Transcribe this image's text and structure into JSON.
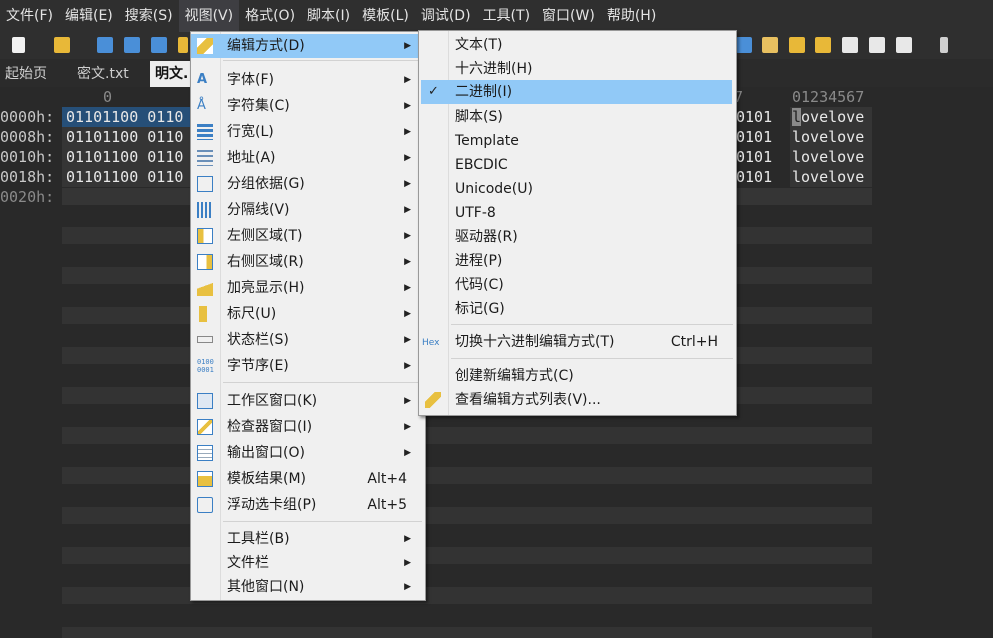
{
  "menubar": [
    "文件(F)",
    "编辑(E)",
    "搜索(S)",
    "视图(V)",
    "格式(O)",
    "脚本(I)",
    "模板(L)",
    "调试(D)",
    "工具(T)",
    "窗口(W)",
    "帮助(H)"
  ],
  "tabs": [
    "起始页",
    "密文.txt",
    "明文."
  ],
  "ruler": {
    "left": "0",
    "right_digit": "7",
    "text_header": "01234567"
  },
  "rows": [
    {
      "addr": "0000h:",
      "bin": "01101100 0110",
      "tail": "0101",
      "text": "lovelove",
      "selected": true
    },
    {
      "addr": "0008h:",
      "bin": "01101100 0110",
      "tail": "0101",
      "text": "lovelove",
      "selected": false
    },
    {
      "addr": "0010h:",
      "bin": "01101100 0110",
      "tail": "0101",
      "text": "lovelove",
      "selected": false
    },
    {
      "addr": "0018h:",
      "bin": "01101100 0110",
      "tail": "0101",
      "text": "lovelove",
      "selected": false
    },
    {
      "addr": "0020h:",
      "bin": "",
      "tail": "",
      "text": "",
      "selected": false
    }
  ],
  "view_menu": [
    {
      "label": "编辑方式(D)",
      "icon": "pencil-icon",
      "submenu": true,
      "highlighted": true
    },
    {
      "label": "字体(F)",
      "icon": "font-icon",
      "submenu": true
    },
    {
      "label": "字符集(C)",
      "icon": "charset-icon",
      "submenu": true
    },
    {
      "label": "行宽(L)",
      "icon": "line-width-icon",
      "submenu": true
    },
    {
      "label": "地址(A)",
      "icon": "address-icon",
      "submenu": true
    },
    {
      "label": "分组依据(G)",
      "icon": "group-icon",
      "submenu": true
    },
    {
      "label": "分隔线(V)",
      "icon": "divider-icon",
      "submenu": true
    },
    {
      "label": "左侧区域(T)",
      "icon": "left-area-icon",
      "submenu": true
    },
    {
      "label": "右侧区域(R)",
      "icon": "right-area-icon",
      "submenu": true
    },
    {
      "label": "加亮显示(H)",
      "icon": "highlight-icon",
      "submenu": true
    },
    {
      "label": "标尺(U)",
      "icon": "ruler-icon",
      "submenu": true
    },
    {
      "label": "状态栏(S)",
      "icon": "statusbar-icon",
      "submenu": true
    },
    {
      "label": "字节序(E)",
      "icon": "byte-order-icon",
      "submenu": true
    },
    {
      "label": "工作区窗口(K)",
      "icon": "workspace-icon",
      "submenu": true
    },
    {
      "label": "检查器窗口(I)",
      "icon": "inspector-icon",
      "submenu": true
    },
    {
      "label": "输出窗口(O)",
      "icon": "output-icon",
      "submenu": true
    },
    {
      "label": "模板结果(M)",
      "icon": "template-results-icon",
      "shortcut": "Alt+4"
    },
    {
      "label": "浮动选卡组(P)",
      "icon": "floating-tabs-icon",
      "shortcut": "Alt+5"
    },
    {
      "label": "工具栏(B)",
      "submenu": true
    },
    {
      "label": "文件栏",
      "submenu": true
    },
    {
      "label": "其他窗口(N)",
      "submenu": true
    }
  ],
  "edit_mode_menu": [
    {
      "label": "文本(T)"
    },
    {
      "label": "十六进制(H)"
    },
    {
      "label": "二进制(I)",
      "checked": true,
      "highlighted": true
    },
    {
      "label": "脚本(S)"
    },
    {
      "label": "Template"
    },
    {
      "label": "EBCDIC"
    },
    {
      "label": "Unicode(U)"
    },
    {
      "label": "UTF-8"
    },
    {
      "label": "驱动器(R)"
    },
    {
      "label": "进程(P)"
    },
    {
      "label": "代码(C)"
    },
    {
      "label": "标记(G)"
    },
    {
      "label": "切换十六进制编辑方式(T)",
      "shortcut": "Ctrl+H",
      "icon_text": "Hex"
    },
    {
      "label": "创建新编辑方式(C)"
    },
    {
      "label": "查看编辑方式列表(V)...",
      "icon": "pencil-icon"
    }
  ],
  "colors": {
    "highlight": "#91c9f7",
    "selection": "#264f78",
    "background": "#292929"
  }
}
